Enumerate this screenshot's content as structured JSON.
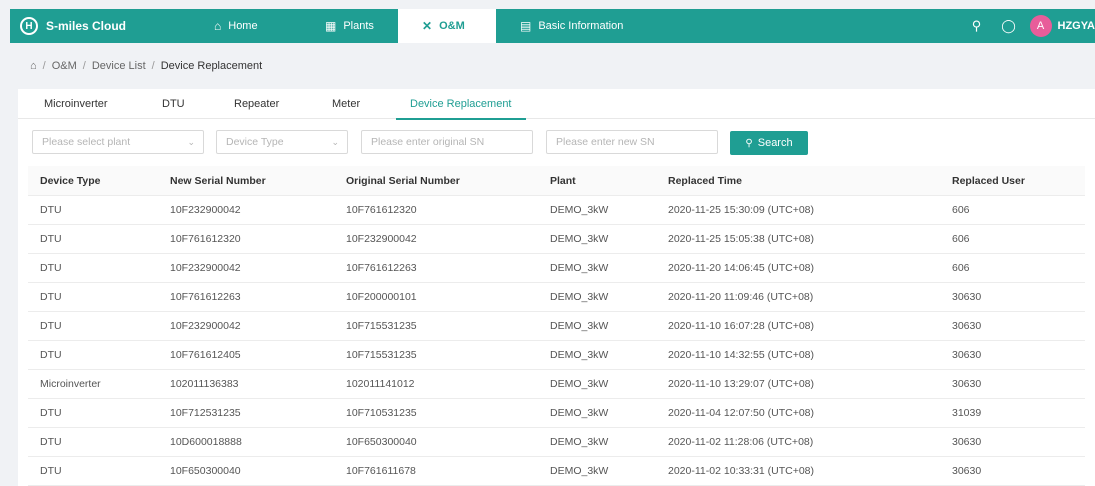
{
  "header": {
    "logo_mark": "H",
    "logo_text": "S-miles Cloud",
    "nav": [
      {
        "label": "Home",
        "icon": "home-icon",
        "glyph": "⌂"
      },
      {
        "label": "Plants",
        "icon": "plants-icon",
        "glyph": "▦"
      },
      {
        "label": "O&M",
        "icon": "tools-icon",
        "glyph": "✕"
      },
      {
        "label": "Basic Information",
        "icon": "document-icon",
        "glyph": "▤"
      }
    ],
    "active_nav": "O&M",
    "avatar_glyph": "A",
    "username": "HZGYA",
    "accent_color": "#1f9e93"
  },
  "breadcrumb": {
    "home_icon": "home-icon",
    "items": [
      "O&M",
      "Device List",
      "Device Replacement"
    ],
    "separator": "/"
  },
  "tabs": [
    {
      "label": "Microinverter"
    },
    {
      "label": "DTU"
    },
    {
      "label": "Repeater"
    },
    {
      "label": "Meter"
    },
    {
      "label": "Device Replacement"
    }
  ],
  "active_tab": "Device Replacement",
  "filters": {
    "plant_placeholder": "Please select plant",
    "device_type_placeholder": "Device Type",
    "original_sn_placeholder": "Please enter original SN",
    "new_sn_placeholder": "Please enter new SN",
    "search_label": "Search"
  },
  "table": {
    "columns": [
      "Device Type",
      "New Serial Number",
      "Original Serial Number",
      "Plant",
      "Replaced Time",
      "Replaced User"
    ],
    "rows": [
      [
        "DTU",
        "10F232900042",
        "10F761612320",
        "DEMO_3kW",
        "2020-11-25 15:30:09 (UTC+08)",
        "606"
      ],
      [
        "DTU",
        "10F761612320",
        "10F232900042",
        "DEMO_3kW",
        "2020-11-25 15:05:38 (UTC+08)",
        "606"
      ],
      [
        "DTU",
        "10F232900042",
        "10F761612263",
        "DEMO_3kW",
        "2020-11-20 14:06:45 (UTC+08)",
        "606"
      ],
      [
        "DTU",
        "10F761612263",
        "10F200000101",
        "DEMO_3kW",
        "2020-11-20 11:09:46 (UTC+08)",
        "30630"
      ],
      [
        "DTU",
        "10F232900042",
        "10F715531235",
        "DEMO_3kW",
        "2020-11-10 16:07:28 (UTC+08)",
        "30630"
      ],
      [
        "DTU",
        "10F761612405",
        "10F715531235",
        "DEMO_3kW",
        "2020-11-10 14:32:55 (UTC+08)",
        "30630"
      ],
      [
        "Microinverter",
        "102011136383",
        "102011141012",
        "DEMO_3kW",
        "2020-11-10 13:29:07 (UTC+08)",
        "30630"
      ],
      [
        "DTU",
        "10F712531235",
        "10F710531235",
        "DEMO_3kW",
        "2020-11-04 12:07:50 (UTC+08)",
        "31039"
      ],
      [
        "DTU",
        "10D600018888",
        "10F650300040",
        "DEMO_3kW",
        "2020-11-02 11:28:06 (UTC+08)",
        "30630"
      ],
      [
        "DTU",
        "10F650300040",
        "10F761611678",
        "DEMO_3kW",
        "2020-11-02 10:33:31 (UTC+08)",
        "30630"
      ]
    ]
  }
}
